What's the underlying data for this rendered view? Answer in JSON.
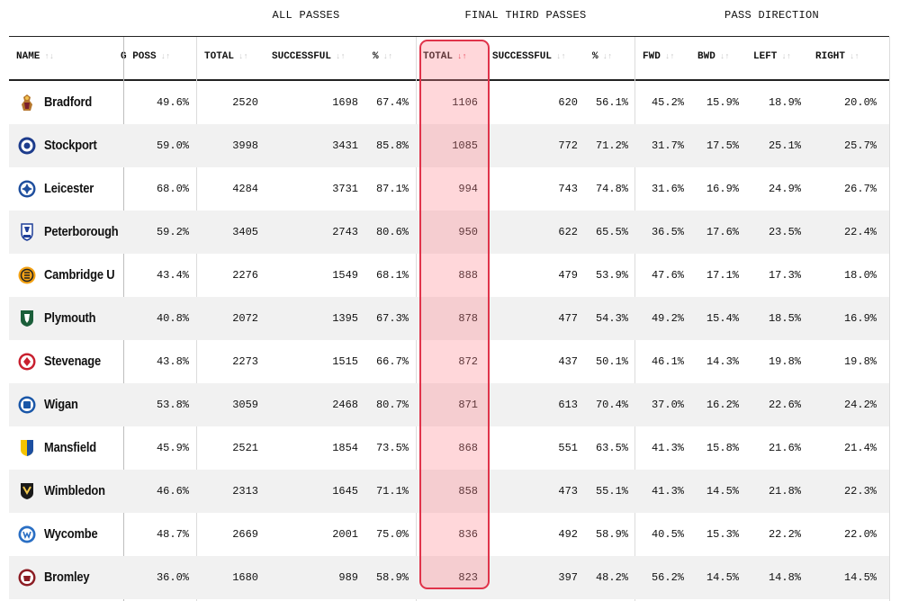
{
  "groups": {
    "all_passes": "ALL PASSES",
    "final_third": "FINAL THIRD PASSES",
    "pass_direction": "PASS DIRECTION"
  },
  "columns": {
    "name": "NAME",
    "poss": "G POSS",
    "total": "TOTAL",
    "successful": "SUCCESSFUL",
    "pct": "%",
    "ft_total": "TOTAL",
    "ft_successful": "SUCCESSFUL",
    "ft_pct": "%",
    "fwd": "FWD",
    "bwd": "BWD",
    "left": "LEFT",
    "right": "RIGHT"
  },
  "sort": {
    "active_column": "final_third_total",
    "direction": "descending",
    "accent": "#e0334a"
  },
  "rows": [
    {
      "team": "Bradford",
      "crest": "bradford-crest",
      "poss": "49.6%",
      "total": "2520",
      "successful": "1698",
      "pct": "67.4%",
      "ft_total": "1106",
      "ft_successful": "620",
      "ft_pct": "56.1%",
      "fwd": "45.2%",
      "bwd": "15.9%",
      "left": "18.9%",
      "right": "20.0%"
    },
    {
      "team": "Stockport",
      "crest": "stockport-crest",
      "poss": "59.0%",
      "total": "3998",
      "successful": "3431",
      "pct": "85.8%",
      "ft_total": "1085",
      "ft_successful": "772",
      "ft_pct": "71.2%",
      "fwd": "31.7%",
      "bwd": "17.5%",
      "left": "25.1%",
      "right": "25.7%"
    },
    {
      "team": "Leicester",
      "crest": "leicester-crest",
      "poss": "68.0%",
      "total": "4284",
      "successful": "3731",
      "pct": "87.1%",
      "ft_total": "994",
      "ft_successful": "743",
      "ft_pct": "74.8%",
      "fwd": "31.6%",
      "bwd": "16.9%",
      "left": "24.9%",
      "right": "26.7%"
    },
    {
      "team": "Peterborough",
      "crest": "peterborough-crest",
      "poss": "59.2%",
      "total": "3405",
      "successful": "2743",
      "pct": "80.6%",
      "ft_total": "950",
      "ft_successful": "622",
      "ft_pct": "65.5%",
      "fwd": "36.5%",
      "bwd": "17.6%",
      "left": "23.5%",
      "right": "22.4%"
    },
    {
      "team": "Cambridge U",
      "crest": "cambridge-crest",
      "poss": "43.4%",
      "total": "2276",
      "successful": "1549",
      "pct": "68.1%",
      "ft_total": "888",
      "ft_successful": "479",
      "ft_pct": "53.9%",
      "fwd": "47.6%",
      "bwd": "17.1%",
      "left": "17.3%",
      "right": "18.0%"
    },
    {
      "team": "Plymouth",
      "crest": "plymouth-crest",
      "poss": "40.8%",
      "total": "2072",
      "successful": "1395",
      "pct": "67.3%",
      "ft_total": "878",
      "ft_successful": "477",
      "ft_pct": "54.3%",
      "fwd": "49.2%",
      "bwd": "15.4%",
      "left": "18.5%",
      "right": "16.9%"
    },
    {
      "team": "Stevenage",
      "crest": "stevenage-crest",
      "poss": "43.8%",
      "total": "2273",
      "successful": "1515",
      "pct": "66.7%",
      "ft_total": "872",
      "ft_successful": "437",
      "ft_pct": "50.1%",
      "fwd": "46.1%",
      "bwd": "14.3%",
      "left": "19.8%",
      "right": "19.8%"
    },
    {
      "team": "Wigan",
      "crest": "wigan-crest",
      "poss": "53.8%",
      "total": "3059",
      "successful": "2468",
      "pct": "80.7%",
      "ft_total": "871",
      "ft_successful": "613",
      "ft_pct": "70.4%",
      "fwd": "37.0%",
      "bwd": "16.2%",
      "left": "22.6%",
      "right": "24.2%"
    },
    {
      "team": "Mansfield",
      "crest": "mansfield-crest",
      "poss": "45.9%",
      "total": "2521",
      "successful": "1854",
      "pct": "73.5%",
      "ft_total": "868",
      "ft_successful": "551",
      "ft_pct": "63.5%",
      "fwd": "41.3%",
      "bwd": "15.8%",
      "left": "21.6%",
      "right": "21.4%"
    },
    {
      "team": "Wimbledon",
      "crest": "wimbledon-crest",
      "poss": "46.6%",
      "total": "2313",
      "successful": "1645",
      "pct": "71.1%",
      "ft_total": "858",
      "ft_successful": "473",
      "ft_pct": "55.1%",
      "fwd": "41.3%",
      "bwd": "14.5%",
      "left": "21.8%",
      "right": "22.3%"
    },
    {
      "team": "Wycombe",
      "crest": "wycombe-crest",
      "poss": "48.7%",
      "total": "2669",
      "successful": "2001",
      "pct": "75.0%",
      "ft_total": "836",
      "ft_successful": "492",
      "ft_pct": "58.9%",
      "fwd": "40.5%",
      "bwd": "15.3%",
      "left": "22.2%",
      "right": "22.0%"
    },
    {
      "team": "Bromley",
      "crest": "bromley-crest",
      "poss": "36.0%",
      "total": "1680",
      "successful": "989",
      "pct": "58.9%",
      "ft_total": "823",
      "ft_successful": "397",
      "ft_pct": "48.2%",
      "fwd": "56.2%",
      "bwd": "14.5%",
      "left": "14.8%",
      "right": "14.5%"
    }
  ]
}
